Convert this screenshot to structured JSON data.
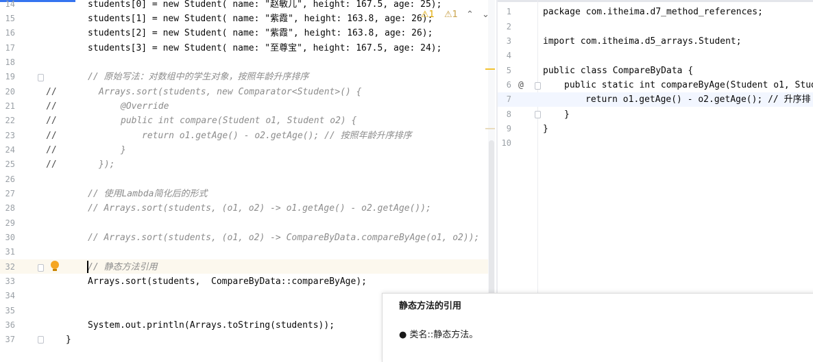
{
  "left_editor": {
    "lines": [
      {
        "n": "14",
        "text": "students[0] = new Student( name: \"赵敏儿\", height: 167.5, age: 25);"
      },
      {
        "n": "15",
        "text": "students[1] = new Student( name: \"紫霞\", height: 163.8, age: 26);"
      },
      {
        "n": "16",
        "text": "students[2] = new Student( name: \"紫霞\", height: 163.8, age: 26);"
      },
      {
        "n": "17",
        "text": "students[3] = new Student( name: \"至尊宝\", height: 167.5, age: 24);"
      },
      {
        "n": "18",
        "text": ""
      },
      {
        "n": "19",
        "text": "// 原始写法：对数组中的学生对象，按照年龄升序排序"
      },
      {
        "n": "20",
        "text": "Arrays.sort(students, new Comparator<Student>() {"
      },
      {
        "n": "21",
        "text": "@Override"
      },
      {
        "n": "22",
        "text": "public int compare(Student o1, Student o2) {"
      },
      {
        "n": "23",
        "text": "return o1.getAge() - o2.getAge(); // 按照年龄升序排序"
      },
      {
        "n": "24",
        "text": "}"
      },
      {
        "n": "25",
        "text": "});"
      },
      {
        "n": "26",
        "text": ""
      },
      {
        "n": "27",
        "text": "// 使用Lambda简化后的形式"
      },
      {
        "n": "28",
        "text": "// Arrays.sort(students, (o1, o2) -> o1.getAge() - o2.getAge());"
      },
      {
        "n": "29",
        "text": ""
      },
      {
        "n": "30",
        "text": "// Arrays.sort(students, (o1, o2) -> CompareByData.compareByAge(o1, o2));"
      },
      {
        "n": "31",
        "text": ""
      },
      {
        "n": "32",
        "text": "// 静态方法引用"
      },
      {
        "n": "33",
        "text": "Arrays.sort(students,  CompareByData::compareByAge);"
      },
      {
        "n": "34",
        "text": ""
      },
      {
        "n": "35",
        "text": ""
      },
      {
        "n": "36",
        "text": "System.out.println(Arrays.toString(students));"
      },
      {
        "n": "37",
        "text": "}"
      }
    ],
    "comment_slash": "//",
    "inspections": {
      "warnings": "1",
      "weak_warnings": "1"
    }
  },
  "right_editor": {
    "lines": [
      {
        "n": "1",
        "text": "package com.itheima.d7_method_references;"
      },
      {
        "n": "2",
        "text": ""
      },
      {
        "n": "3",
        "text": "import com.itheima.d5_arrays.Student;"
      },
      {
        "n": "4",
        "text": ""
      },
      {
        "n": "5",
        "text": "public class CompareByData {"
      },
      {
        "n": "6",
        "text": "public static int compareByAge(Student o1, Stud"
      },
      {
        "n": "7",
        "text": "return o1.getAge() - o2.getAge(); // 升序排"
      },
      {
        "n": "8",
        "text": "}"
      },
      {
        "n": "9",
        "text": "}"
      },
      {
        "n": "10",
        "text": ""
      }
    ],
    "gutter_marker": "@"
  },
  "doc_popup": {
    "title": "静态方法的引用",
    "bullet": "类名::静态方法。"
  },
  "colors": {
    "keyword": "#0033b3",
    "number": "#1750eb",
    "string": "#067d17",
    "comment": "#8c8c8c",
    "selection": "#a6d2ff"
  }
}
